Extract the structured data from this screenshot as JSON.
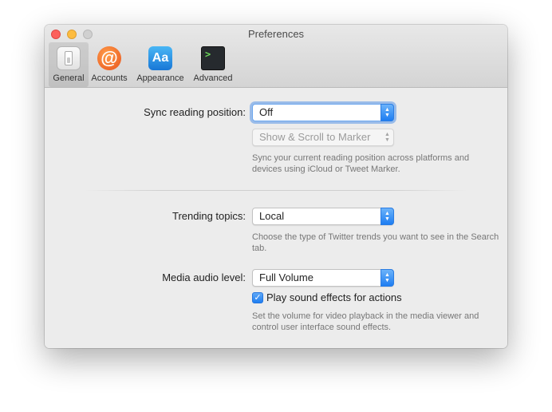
{
  "window": {
    "title": "Preferences"
  },
  "toolbar": {
    "items": [
      {
        "label": "General",
        "icon": "general-icon",
        "selected": true
      },
      {
        "label": "Accounts",
        "icon": "at-sign-icon",
        "glyph": "@"
      },
      {
        "label": "Appearance",
        "icon": "font-aa-icon",
        "glyph": "Aa"
      },
      {
        "label": "Advanced",
        "icon": "terminal-icon",
        "glyph": ">"
      }
    ]
  },
  "sync": {
    "label": "Sync reading position:",
    "value": "Off",
    "secondary_value": "Show & Scroll to Marker",
    "help": "Sync your current reading position across platforms and devices using iCloud or Tweet Marker."
  },
  "trending": {
    "label": "Trending topics:",
    "value": "Local",
    "help": "Choose the type of Twitter trends you want to see in the Search tab."
  },
  "media": {
    "label": "Media audio level:",
    "value": "Full Volume",
    "checkbox_label": "Play sound effects for actions",
    "checkbox_checked": true,
    "help": "Set the volume for video playback in the media viewer and control user interface sound effects."
  },
  "colors": {
    "accent": "#1f7ef1",
    "close": "#fc605c",
    "minimize": "#fdbc40",
    "zoom_disabled": "#d0d0d0"
  }
}
